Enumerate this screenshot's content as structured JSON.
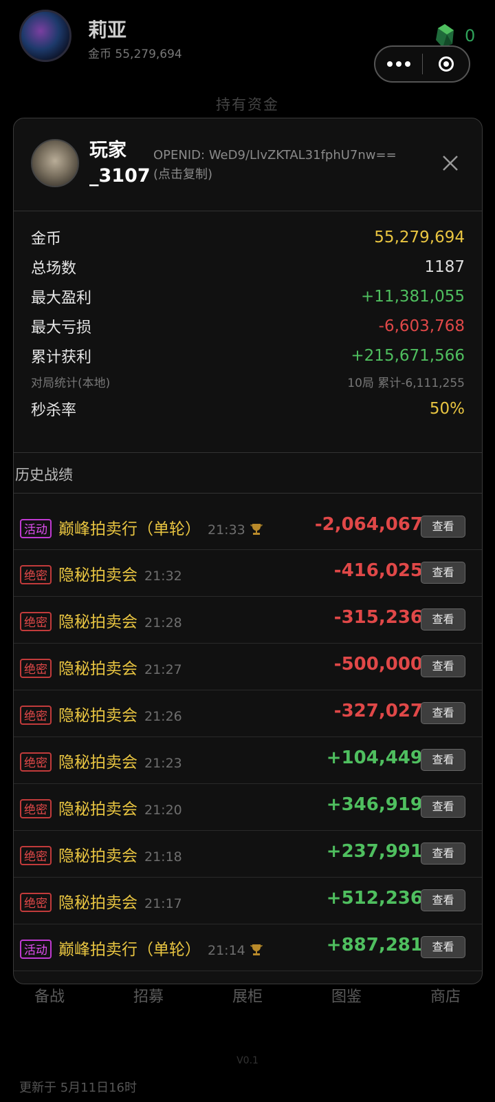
{
  "header": {
    "user_name": "莉亚",
    "coins_label": "金币 55,279,694",
    "gem_count": "0",
    "section_hint": "持有资金"
  },
  "bottom_nav": {
    "tabs": [
      "备战",
      "招募",
      "展柜",
      "图鉴",
      "商店"
    ],
    "version": "V0.1",
    "updated": "更新于 5月11日16时"
  },
  "modal": {
    "player_name": "玩家_3107",
    "openid_label": "OPENID: WeD9/LIvZKTAL31fphU7nw==",
    "copy_hint": "(点击复制)",
    "stats": [
      {
        "key": "金币",
        "value": "55,279,694",
        "tone": "gold"
      },
      {
        "key": "总场数",
        "value": "1187",
        "tone": "white"
      },
      {
        "key": "最大盈利",
        "value": "+11,381,055",
        "tone": "green"
      },
      {
        "key": "最大亏损",
        "value": "-6,603,768",
        "tone": "red"
      },
      {
        "key": "累计获利",
        "value": "+215,671,566",
        "tone": "green"
      },
      {
        "key": "对局统计(本地)",
        "value": "10局 累计-6,111,255",
        "tone": "small"
      },
      {
        "key": "秒杀率",
        "value": "50%",
        "tone": "gold"
      }
    ],
    "history_title": "历史战绩",
    "view_label": "查看",
    "history": [
      {
        "tag": "活动",
        "tag_type": "act",
        "name": "巅峰拍卖行（单轮）",
        "time": "21:33",
        "trophy": true,
        "value": "-2,064,067",
        "tone": "red"
      },
      {
        "tag": "绝密",
        "tag_type": "sec",
        "name": "隐秘拍卖会",
        "time": "21:32",
        "trophy": false,
        "value": "-416,025",
        "tone": "red"
      },
      {
        "tag": "绝密",
        "tag_type": "sec",
        "name": "隐秘拍卖会",
        "time": "21:28",
        "trophy": false,
        "value": "-315,236",
        "tone": "red"
      },
      {
        "tag": "绝密",
        "tag_type": "sec",
        "name": "隐秘拍卖会",
        "time": "21:27",
        "trophy": false,
        "value": "-500,000",
        "tone": "red"
      },
      {
        "tag": "绝密",
        "tag_type": "sec",
        "name": "隐秘拍卖会",
        "time": "21:26",
        "trophy": false,
        "value": "-327,027",
        "tone": "red"
      },
      {
        "tag": "绝密",
        "tag_type": "sec",
        "name": "隐秘拍卖会",
        "time": "21:23",
        "trophy": false,
        "value": "+104,449",
        "tone": "green"
      },
      {
        "tag": "绝密",
        "tag_type": "sec",
        "name": "隐秘拍卖会",
        "time": "21:20",
        "trophy": false,
        "value": "+346,919",
        "tone": "green"
      },
      {
        "tag": "绝密",
        "tag_type": "sec",
        "name": "隐秘拍卖会",
        "time": "21:18",
        "trophy": false,
        "value": "+237,991",
        "tone": "green"
      },
      {
        "tag": "绝密",
        "tag_type": "sec",
        "name": "隐秘拍卖会",
        "time": "21:17",
        "trophy": false,
        "value": "+512,236",
        "tone": "green"
      },
      {
        "tag": "活动",
        "tag_type": "act",
        "name": "巅峰拍卖行（单轮）",
        "time": "21:14",
        "trophy": true,
        "value": "+887,281",
        "tone": "green"
      }
    ]
  }
}
